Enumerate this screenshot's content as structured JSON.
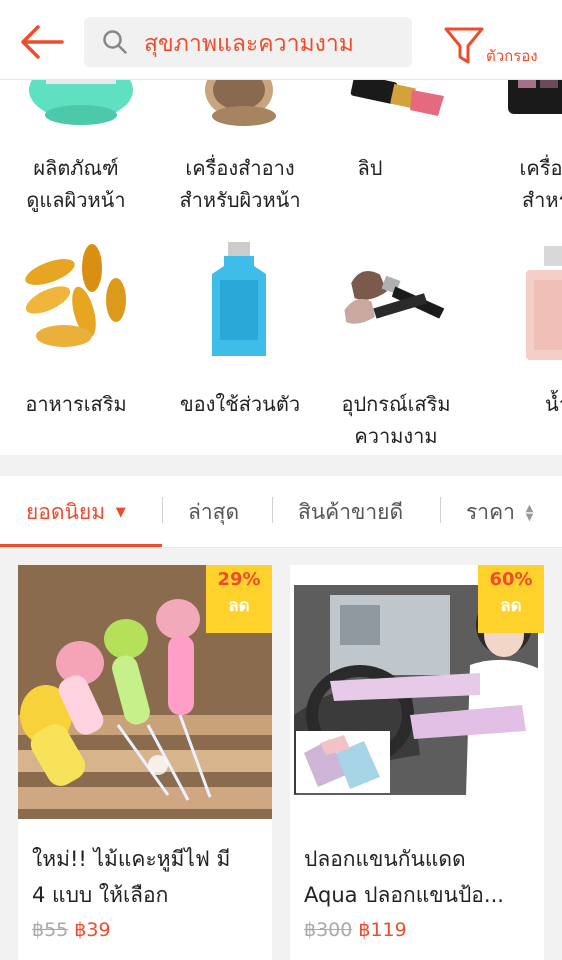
{
  "header": {
    "search_query": "สุขภาพและความงาม",
    "filter_label": "ตัวกรอง"
  },
  "categories": [
    {
      "lines": [
        "ผลิตภัณฑ์",
        "ดูแลผิวหน้า"
      ]
    },
    {
      "lines": [
        "เครื่องสำอาง",
        "สำหรับผิวหน้า"
      ]
    },
    {
      "lines": [
        "ลิป"
      ]
    },
    {
      "lines": [
        "เครื่องส",
        "สำหรับ"
      ]
    },
    {
      "lines": [
        "อาหารเสริม"
      ]
    },
    {
      "lines": [
        "ของใช้ส่วนตัว"
      ]
    },
    {
      "lines": [
        "อุปกรณ์เสริม",
        "ความงาม"
      ]
    },
    {
      "lines": [
        "น้ำห"
      ]
    }
  ],
  "sort_tabs": [
    "ยอดนิยม",
    "ล่าสุด",
    "สินค้าขายดี",
    "ราคา"
  ],
  "active_sort": "ยอดนิยม",
  "products": [
    {
      "discount": "29%",
      "discount_label": "ลด",
      "title_lines": [
        "ใหม่!! ไม้แคะหูมีไฟ มี",
        "4 แบบ ให้เลือก"
      ],
      "old_price": "฿55",
      "price": "฿39"
    },
    {
      "discount": "60%",
      "discount_label": "ลด",
      "title_lines": [
        "ปลอกแขนกันแดด",
        "Aqua ปลอกแขนป้อ..."
      ],
      "old_price": "฿300",
      "price": "฿119"
    }
  ],
  "colors": {
    "brand": "#ee4d2d",
    "badge": "#ffd22b"
  }
}
